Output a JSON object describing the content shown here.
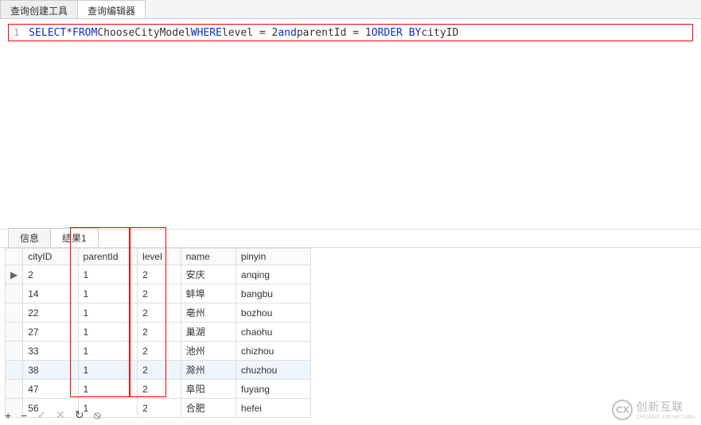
{
  "top_tabs": {
    "builder": "查询创建工具",
    "editor": "查询编辑器"
  },
  "sql": {
    "line_no": "1",
    "select": "SELECT",
    "star_from": " * ",
    "from": "FROM",
    "table": " ChooseCityModel ",
    "where": "WHERE",
    "cond1": "  level = 2  ",
    "and": "and",
    "cond2": " parentId = 1",
    "order": " ORDER BY",
    "tail": " cityID"
  },
  "mid_tabs": {
    "info": "信息",
    "result": "结果1"
  },
  "columns": {
    "cityID": "cityID",
    "parentId": "parentId",
    "level": "level",
    "name": "name",
    "pinyin": "pinyin"
  },
  "rows": [
    {
      "cityID": "2",
      "parentId": "1",
      "level": "2",
      "name": "安庆",
      "pinyin": "anqing",
      "mark": "▶"
    },
    {
      "cityID": "14",
      "parentId": "1",
      "level": "2",
      "name": "蚌埠",
      "pinyin": "bangbu",
      "mark": ""
    },
    {
      "cityID": "22",
      "parentId": "1",
      "level": "2",
      "name": "亳州",
      "pinyin": "bozhou",
      "mark": ""
    },
    {
      "cityID": "27",
      "parentId": "1",
      "level": "2",
      "name": "巢湖",
      "pinyin": "chaohu",
      "mark": ""
    },
    {
      "cityID": "33",
      "parentId": "1",
      "level": "2",
      "name": "池州",
      "pinyin": "chizhou",
      "mark": ""
    },
    {
      "cityID": "38",
      "parentId": "1",
      "level": "2",
      "name": "滁州",
      "pinyin": "chuzhou",
      "mark": ""
    },
    {
      "cityID": "47",
      "parentId": "1",
      "level": "2",
      "name": "阜阳",
      "pinyin": "fuyang",
      "mark": ""
    },
    {
      "cityID": "56",
      "parentId": "1",
      "level": "2",
      "name": "合肥",
      "pinyin": "hefei",
      "mark": ""
    }
  ],
  "toolbar": {
    "add": "+",
    "del": "−",
    "apply": "✓",
    "cancel": "✕",
    "refresh": "↻",
    "stop": "⦸"
  },
  "watermark": {
    "logo": "CX",
    "text": "创新互联",
    "sub": "CHUANG XIN HU LIAN"
  }
}
